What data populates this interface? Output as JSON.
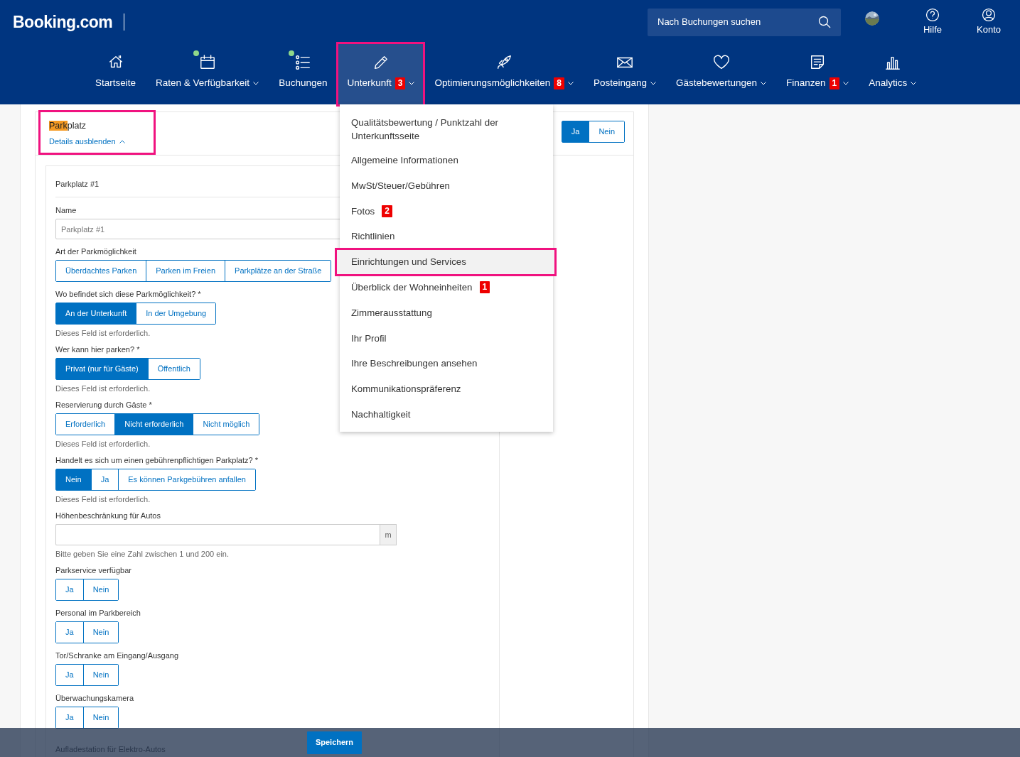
{
  "header": {
    "logo": "Booking.com",
    "search": {
      "placeholder": "Nach Buchungen suchen"
    },
    "links": [
      {
        "label": "Hilfe"
      },
      {
        "label": "Konto"
      }
    ]
  },
  "nav": [
    {
      "label": "Startseite",
      "selected": false,
      "dot": false,
      "dropdown": false,
      "highlighted": false
    },
    {
      "label": "Raten & Verfügbarkeit",
      "selected": false,
      "dot": true,
      "dropdown": true,
      "highlighted": false
    },
    {
      "label": "Buchungen",
      "selected": false,
      "dot": true,
      "dropdown": false,
      "highlighted": false
    },
    {
      "label": "Unterkunft",
      "selected": true,
      "dot": false,
      "dropdown": true,
      "badge": "3",
      "highlighted": true
    },
    {
      "label": "Optimierungsmöglichkeiten",
      "selected": false,
      "dot": false,
      "dropdown": true,
      "badge": "8",
      "highlighted": false
    },
    {
      "label": "Posteingang",
      "selected": false,
      "dot": false,
      "dropdown": true,
      "highlighted": false
    },
    {
      "label": "Gästebewertungen",
      "selected": false,
      "dot": false,
      "dropdown": true,
      "highlighted": false
    },
    {
      "label": "Finanzen",
      "selected": false,
      "dot": false,
      "dropdown": true,
      "badge": "1",
      "highlighted": false
    },
    {
      "label": "Analytics",
      "selected": false,
      "dot": false,
      "dropdown": true,
      "highlighted": false
    }
  ],
  "menu": {
    "items": [
      {
        "label": "Qualitätsbewertung / Punktzahl der Unterkunftsseite",
        "selected": false,
        "highlighted": false
      },
      {
        "label": "Allgemeine Informationen",
        "selected": false,
        "highlighted": false
      },
      {
        "label": "MwSt/Steuer/Gebühren",
        "selected": false,
        "highlighted": false
      },
      {
        "label": "Fotos",
        "badge": "2",
        "selected": false,
        "highlighted": false
      },
      {
        "label": "Richtlinien",
        "selected": false,
        "highlighted": false
      },
      {
        "label": "Einrichtungen und Services",
        "selected": true,
        "highlighted": true
      },
      {
        "label": "Überblick der Wohneinheiten",
        "badge": "1",
        "selected": false,
        "highlighted": false
      },
      {
        "label": "Zimmerausstattung",
        "selected": false,
        "highlighted": false
      },
      {
        "label": "Ihr Profil",
        "selected": false,
        "highlighted": false
      },
      {
        "label": "Ihre Beschreibungen ansehen",
        "selected": false,
        "highlighted": false
      },
      {
        "label": "Kommunikationspräferenz",
        "selected": false,
        "highlighted": false
      },
      {
        "label": "Nachhaltigkeit",
        "selected": false,
        "highlighted": false
      }
    ]
  },
  "section": {
    "title_match": "Park",
    "title_rest": "platz",
    "toggle_link": "Details ausblenden",
    "highlighted": true,
    "answer": [
      {
        "label": "Ja",
        "selected": true
      },
      {
        "label": "Nein",
        "selected": false
      }
    ]
  },
  "entry": {
    "title": "Parkplatz #1",
    "fields": [
      {
        "kind": "text",
        "label": "Name",
        "value": "Parkplatz #1"
      },
      {
        "kind": "choice",
        "label": "Art der Parkmöglichkeit",
        "options": [
          {
            "label": "Überdachtes Parken",
            "selected": false
          },
          {
            "label": "Parken im Freien",
            "selected": false
          },
          {
            "label": "Parkplätze an der Straße",
            "selected": false
          }
        ]
      },
      {
        "kind": "choice",
        "label": "Wo befindet sich diese Parkmöglichkeit? *",
        "options": [
          {
            "label": "An der Unterkunft",
            "selected": true
          },
          {
            "label": "In der Umgebung",
            "selected": false
          }
        ],
        "note": "Dieses Feld ist erforderlich."
      },
      {
        "kind": "choice",
        "label": "Wer kann hier parken? *",
        "options": [
          {
            "label": "Privat (nur für Gäste)",
            "selected": true
          },
          {
            "label": "Öffentlich",
            "selected": false
          }
        ],
        "note": "Dieses Feld ist erforderlich."
      },
      {
        "kind": "choice",
        "label": "Reservierung durch Gäste *",
        "options": [
          {
            "label": "Erforderlich",
            "selected": false
          },
          {
            "label": "Nicht erforderlich",
            "selected": true
          },
          {
            "label": "Nicht möglich",
            "selected": false
          }
        ],
        "note": "Dieses Feld ist erforderlich."
      },
      {
        "kind": "choice",
        "label": "Handelt es sich um einen gebührenpflichtigen Parkplatz? *",
        "options": [
          {
            "label": "Nein",
            "selected": true
          },
          {
            "label": "Ja",
            "selected": false
          },
          {
            "label": "Es können Parkgebühren anfallen",
            "selected": false
          }
        ],
        "note": "Dieses Feld ist erforderlich."
      },
      {
        "kind": "unit",
        "label": "Höhenbeschränkung für Autos",
        "unit": "m",
        "note": "Bitte geben Sie eine Zahl zwischen 1 und 200 ein."
      },
      {
        "kind": "choice",
        "label": "Parkservice verfügbar",
        "options": [
          {
            "label": "Ja",
            "selected": false
          },
          {
            "label": "Nein",
            "selected": false
          }
        ]
      },
      {
        "kind": "choice",
        "label": "Personal im Parkbereich",
        "options": [
          {
            "label": "Ja",
            "selected": false
          },
          {
            "label": "Nein",
            "selected": false
          }
        ]
      },
      {
        "kind": "choice",
        "label": "Tor/Schranke am Eingang/Ausgang",
        "options": [
          {
            "label": "Ja",
            "selected": false
          },
          {
            "label": "Nein",
            "selected": false
          }
        ]
      },
      {
        "kind": "choice",
        "label": "Überwachungskamera",
        "options": [
          {
            "label": "Ja",
            "selected": false
          },
          {
            "label": "Nein",
            "selected": false
          }
        ]
      },
      {
        "kind": "label",
        "label": "Aufladestation für Elektro-Autos"
      }
    ]
  },
  "footer": {
    "save": "Speichern"
  }
}
